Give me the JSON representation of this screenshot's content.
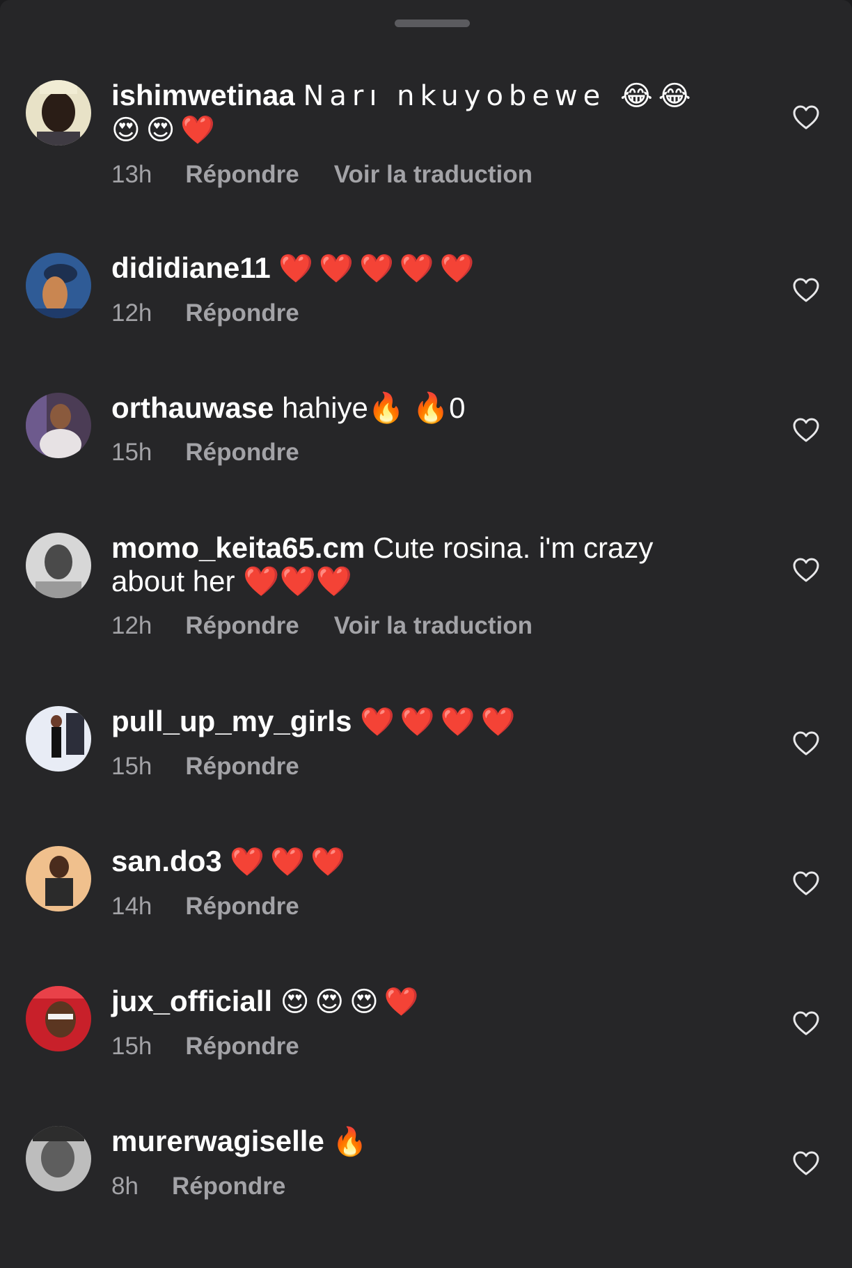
{
  "comments": [
    {
      "username": "ishimwetinaa",
      "text": "Narı nkuyobewe 😂😂😍😍❤️",
      "time": "13h",
      "reply_label": "Répondre",
      "translate_label": "Voir la traduction",
      "avatar_icon": "user-avatar-icon"
    },
    {
      "username": "dididiane11",
      "text": "❤️❤️❤️❤️❤️",
      "time": "12h",
      "reply_label": "Répondre",
      "avatar_icon": "user-avatar-icon"
    },
    {
      "username": "orthauwase",
      "text": "hahiye🔥 🔥0",
      "time": "15h",
      "reply_label": "Répondre",
      "avatar_icon": "user-avatar-icon"
    },
    {
      "username": "momo_keita65.cm",
      "text": "Cute rosina. i'm crazy about her ❤️❤️❤️",
      "time": "12h",
      "reply_label": "Répondre",
      "translate_label": "Voir la traduction",
      "avatar_icon": "user-avatar-icon"
    },
    {
      "username": "pull_up_my_girls",
      "text": "❤️❤️❤️❤️",
      "time": "15h",
      "reply_label": "Répondre",
      "avatar_icon": "user-avatar-icon"
    },
    {
      "username": "san.do3",
      "text": "❤️❤️❤️",
      "time": "14h",
      "reply_label": "Répondre",
      "avatar_icon": "user-avatar-icon"
    },
    {
      "username": "jux_officiall",
      "text": "😍😍😍❤️",
      "time": "15h",
      "reply_label": "Répondre",
      "avatar_icon": "user-avatar-icon"
    },
    {
      "username": "murerwagiselle",
      "text": "🔥",
      "time": "8h",
      "reply_label": "Répondre",
      "avatar_icon": "user-avatar-icon"
    }
  ],
  "icons": {
    "like": "heart-outline-icon",
    "grabber": "sheet-handle"
  },
  "colors": {
    "background": "#262628",
    "text": "#ffffff",
    "meta": "#a3a3a7"
  }
}
